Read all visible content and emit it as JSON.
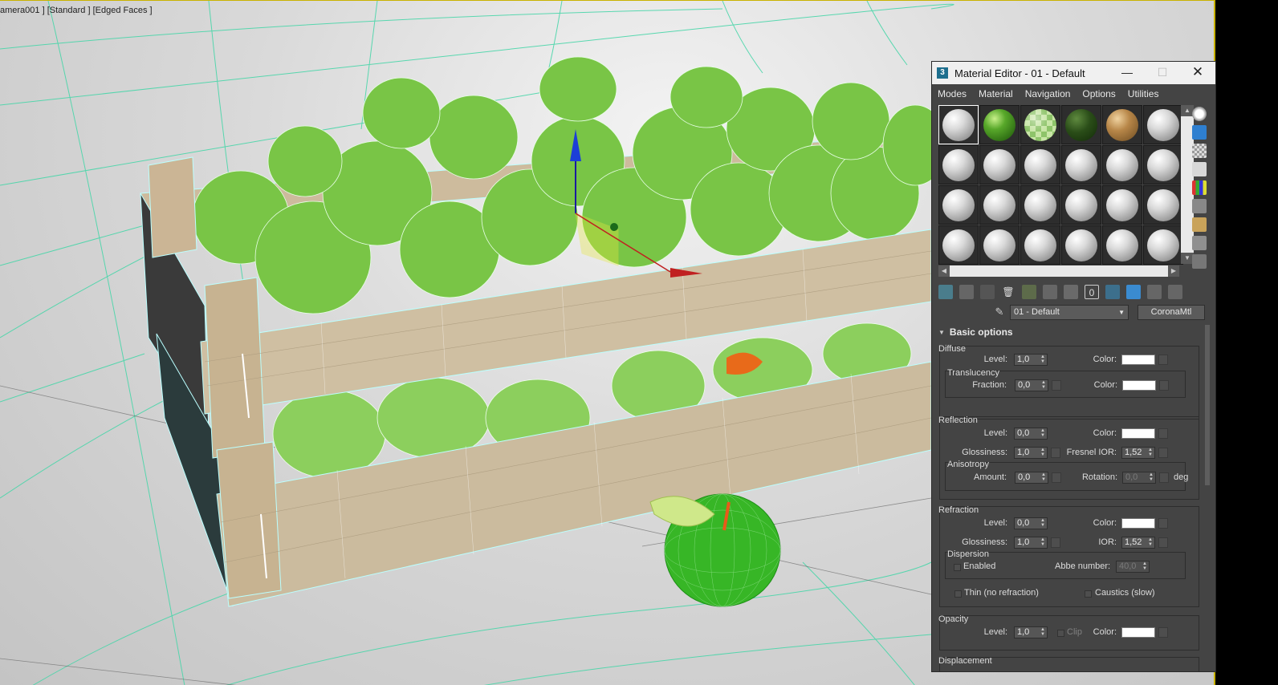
{
  "viewport": {
    "label": "amera001 ] [Standard ] [Edged Faces ]"
  },
  "material_editor": {
    "title": "Material Editor - 01 - Default",
    "app_icon": "3",
    "window_buttons": {
      "minimize": "—",
      "maximize": "☐",
      "close": "✕"
    },
    "menu": [
      "Modes",
      "Material",
      "Navigation",
      "Options",
      "Utilities"
    ],
    "slots": [
      {
        "kind": "default",
        "active": true
      },
      {
        "kind": "green"
      },
      {
        "kind": "checker"
      },
      {
        "kind": "dkgreen"
      },
      {
        "kind": "wood"
      },
      {
        "kind": "default"
      },
      {
        "kind": "default"
      },
      {
        "kind": "default"
      },
      {
        "kind": "default"
      },
      {
        "kind": "default"
      },
      {
        "kind": "default"
      },
      {
        "kind": "default"
      },
      {
        "kind": "default"
      },
      {
        "kind": "default"
      },
      {
        "kind": "default"
      },
      {
        "kind": "default"
      },
      {
        "kind": "default"
      },
      {
        "kind": "default"
      },
      {
        "kind": "default"
      },
      {
        "kind": "default"
      },
      {
        "kind": "default"
      },
      {
        "kind": "default"
      },
      {
        "kind": "default"
      },
      {
        "kind": "default"
      }
    ],
    "material_name": "01 - Default",
    "material_type": "CoronaMtl",
    "rollout_title": "Basic options",
    "diffuse": {
      "title": "Diffuse",
      "level_label": "Level:",
      "level": "1,0",
      "color_label": "Color:",
      "translucency": {
        "title": "Translucency",
        "fraction_label": "Fraction:",
        "fraction": "0,0",
        "color_label": "Color:"
      }
    },
    "reflection": {
      "title": "Reflection",
      "level_label": "Level:",
      "level": "0,0",
      "color_label": "Color:",
      "glossiness_label": "Glossiness:",
      "glossiness": "1,0",
      "fresnel_label": "Fresnel IOR:",
      "fresnel": "1,52",
      "anisotropy": {
        "title": "Anisotropy",
        "amount_label": "Amount:",
        "amount": "0,0",
        "rotation_label": "Rotation:",
        "rotation": "0,0",
        "unit": "deg"
      }
    },
    "refraction": {
      "title": "Refraction",
      "level_label": "Level:",
      "level": "0,0",
      "color_label": "Color:",
      "glossiness_label": "Glossiness:",
      "glossiness": "1,0",
      "ior_label": "IOR:",
      "ior": "1,52",
      "dispersion": {
        "title": "Dispersion",
        "enabled_label": "Enabled",
        "abbe_label": "Abbe number:",
        "abbe": "40,0"
      },
      "thin_label": "Thin (no refraction)",
      "caustics_label": "Caustics (slow)"
    },
    "opacity": {
      "title": "Opacity",
      "level_label": "Level:",
      "level": "1,0",
      "clip_label": "Clip",
      "color_label": "Color:"
    },
    "displacement": {
      "title": "Displacement"
    }
  }
}
